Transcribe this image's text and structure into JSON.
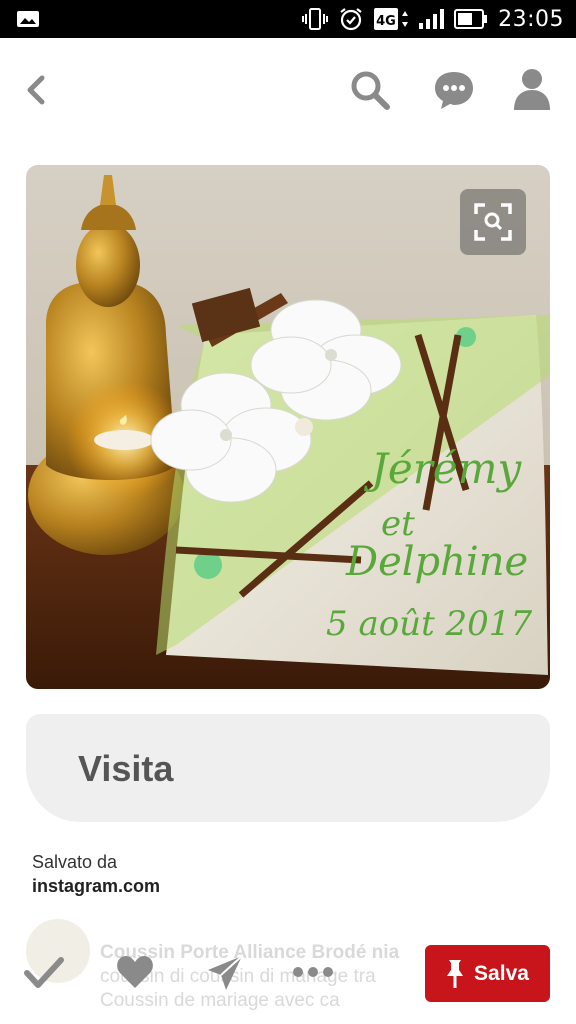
{
  "status_bar": {
    "time": "23:05",
    "network": "4G",
    "icons": [
      "image-notification-icon",
      "vibrate-icon",
      "alarm-icon",
      "network-4g-icon",
      "signal-icon",
      "battery-icon"
    ]
  },
  "top_nav": {
    "icons": [
      "back-icon",
      "search-icon",
      "chat-icon",
      "profile-icon"
    ]
  },
  "pin": {
    "photo_inscription": {
      "line1": "Jérémy",
      "line2": "et",
      "line3": "Delphine",
      "line4": "5 août 2017"
    },
    "lens_icon": "visual-search-icon"
  },
  "visit_button": {
    "label": "Visita"
  },
  "saved_from": {
    "label": "Salvato da",
    "source": "instagram.com"
  },
  "pinner": {
    "name": "Coussin Porte Alliance Brodé",
    "description_line1": "... e... ... ... ...",
    "description_line2": "Coussin de mariage avec ...",
    "faded_lines": [
      "Coussin Porte Alliance Brodé nia",
      "coussin di coussin di mariage tra",
      "Coussin de mariage avec ca"
    ]
  },
  "action_bar": {
    "icons": [
      "checkmark-icon",
      "heart-icon",
      "send-icon",
      "more-icon"
    ],
    "save_label": "Salva",
    "save_color": "#c8151b"
  },
  "colors": {
    "nav_icon": "#888888",
    "visit_bg": "#efefef",
    "accent_red": "#c8151b"
  }
}
